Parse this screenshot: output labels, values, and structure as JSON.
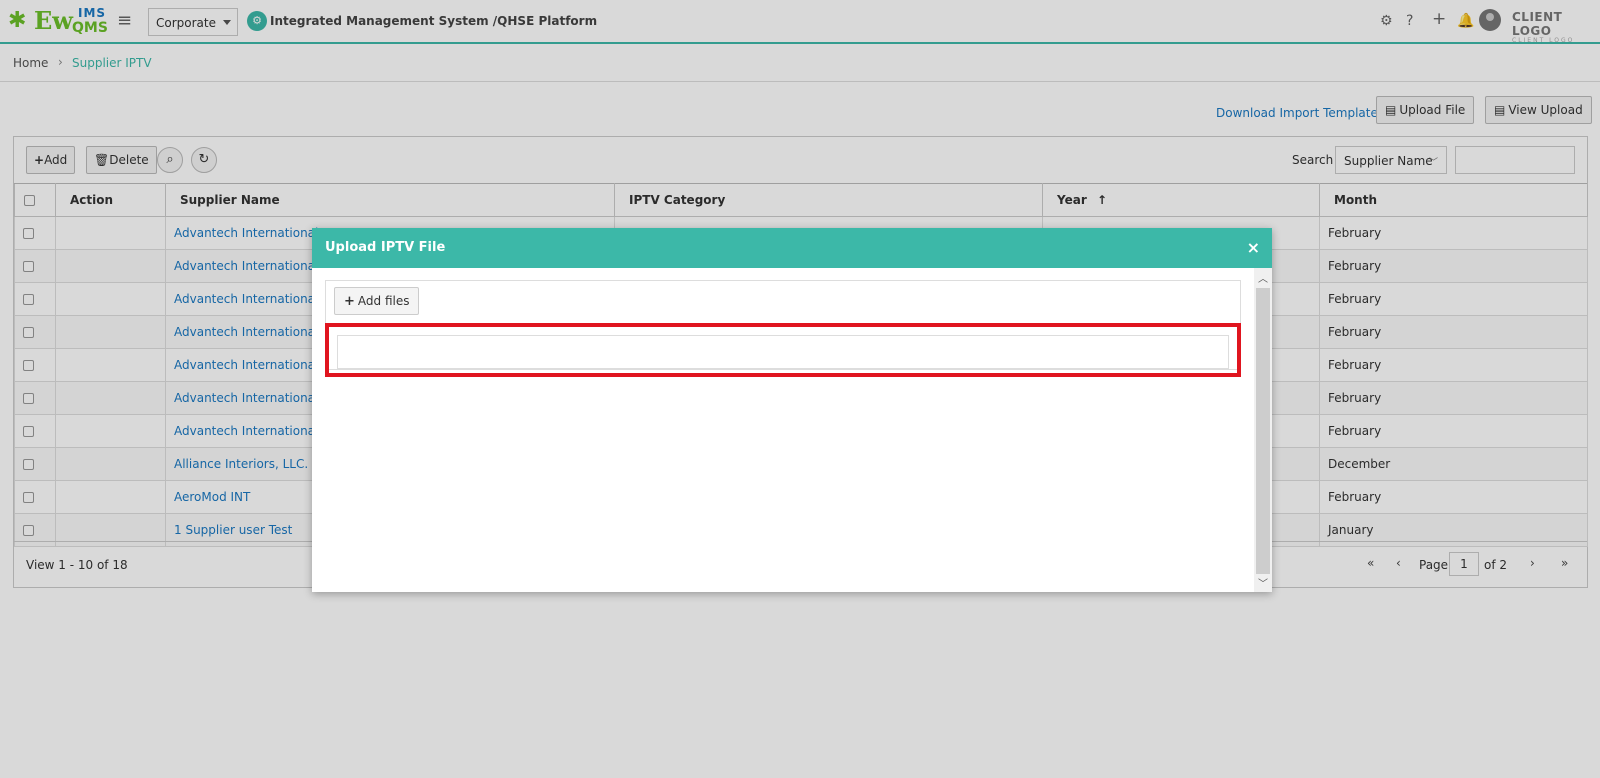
{
  "header": {
    "logo": {
      "ew": "Ew",
      "ims": "IMS",
      "qms": "QMS"
    },
    "corporate_select": "Corporate",
    "system_title": "Integrated Management System /QHSE Platform",
    "client_logo": "CLIENT LOGO",
    "client_logo_sub": "CLIENT LOGO",
    "icons": [
      "gear-icon",
      "help-icon",
      "plus-icon",
      "bell-icon",
      "avatar"
    ]
  },
  "breadcrumb": {
    "home": "Home",
    "separator": "›",
    "current": "Supplier IPTV"
  },
  "actions": {
    "download_template": "Download Import Template",
    "upload_file": "Upload File",
    "view_upload": "View Upload"
  },
  "toolbar": {
    "add": "Add",
    "delete": "Delete",
    "search_label": "Search",
    "search_field": "Supplier Name",
    "search_value": ""
  },
  "table": {
    "columns": [
      "Action",
      "Supplier Name",
      "IPTV Category",
      "Year",
      "Month"
    ],
    "sort_column": "Year",
    "rows": [
      {
        "supplier": "Advantech International",
        "category": "",
        "year": "",
        "month": "February"
      },
      {
        "supplier": "Advantech International",
        "category": "",
        "year": "",
        "month": "February"
      },
      {
        "supplier": "Advantech International",
        "category": "",
        "year": "",
        "month": "February"
      },
      {
        "supplier": "Advantech International",
        "category": "",
        "year": "",
        "month": "February"
      },
      {
        "supplier": "Advantech International",
        "category": "",
        "year": "",
        "month": "February"
      },
      {
        "supplier": "Advantech International",
        "category": "",
        "year": "",
        "month": "February"
      },
      {
        "supplier": "Advantech International",
        "category": "",
        "year": "",
        "month": "February"
      },
      {
        "supplier": "Alliance Interiors, LLC.",
        "category": "",
        "year": "",
        "month": "December"
      },
      {
        "supplier": "AeroMod INT",
        "category": "",
        "year": "",
        "month": "February"
      },
      {
        "supplier": "1 Supplier user Test",
        "category": "",
        "year": "",
        "month": "January"
      }
    ]
  },
  "pager": {
    "view_text": "View 1 - 10 of 18",
    "page_label": "Page",
    "page_value": "1",
    "of_label": "of 2"
  },
  "modal": {
    "title": "Upload IPTV File",
    "close": "×",
    "add_files": "Add files"
  },
  "colors": {
    "accent": "#3cb8a8",
    "link": "#1a78c2",
    "highlight": "#e0151f"
  }
}
